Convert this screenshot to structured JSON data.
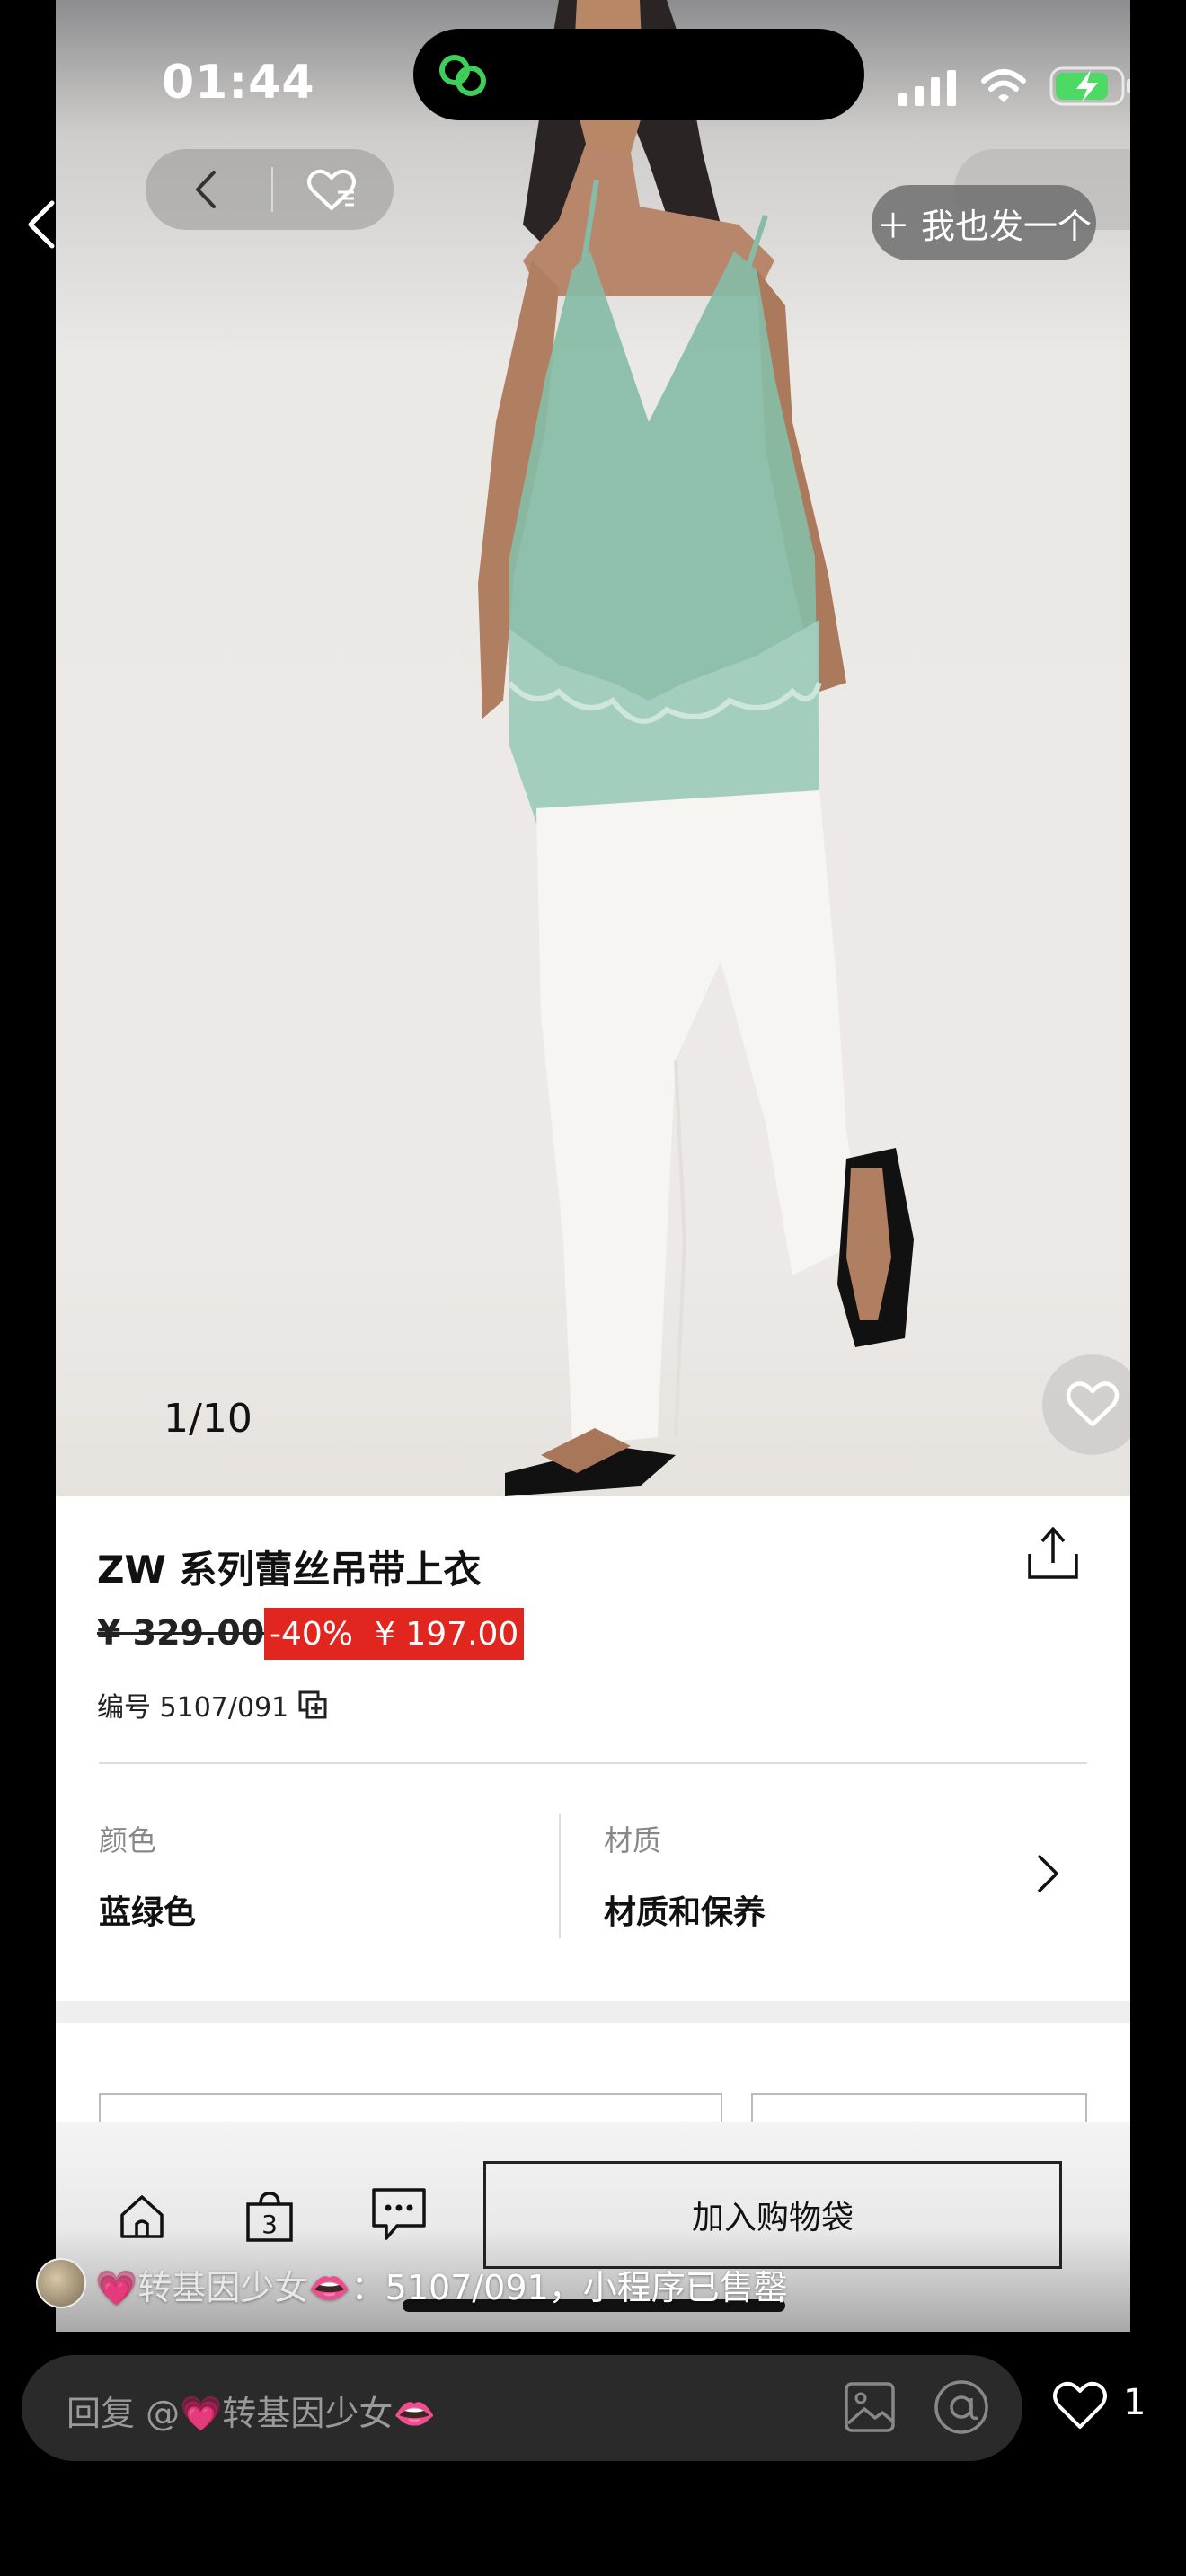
{
  "status_bar": {
    "time": "01:44"
  },
  "post": {
    "post_also_label": "＋ 我也发一个"
  },
  "product": {
    "page_indicator": "1/10",
    "title": "ZW 系列蕾丝吊带上衣",
    "price_original": "¥ 329.00",
    "discount": "-40%",
    "price_sale": "¥ 197.00",
    "sku_label": "编号 5107/091",
    "color_label": "颜色",
    "color_value": "蓝绿色",
    "material_label": "材质",
    "material_value": "材质和保养",
    "bag_count": "3",
    "add_to_bag_label": "加入购物袋"
  },
  "comment": {
    "heart": "💗",
    "name": "转基因少女",
    "lips": "👄",
    "text": "：5107/091，小程序已售罄"
  },
  "reply": {
    "prefix": "回复 @",
    "heart": "💗",
    "name": "转基因少女",
    "lips": "👄"
  },
  "likes": {
    "count": "1"
  },
  "colors": {
    "discount_red": "#e0261e",
    "garment_green": "#86bca6"
  }
}
